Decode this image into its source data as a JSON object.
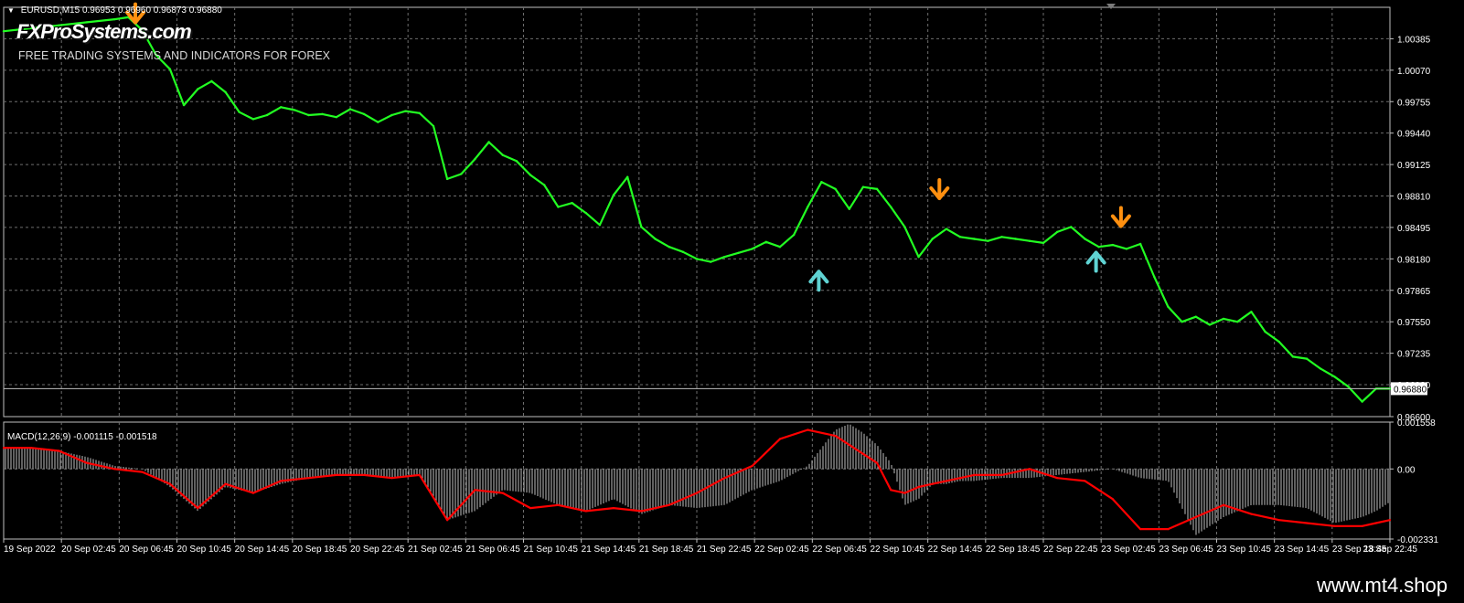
{
  "header": {
    "symbol_info": "EURUSD,M15  0.96953 0.96960 0.96873 0.96880",
    "brand_name": "FXProSystems.com",
    "brand_tagline": "FREE TRADING SYSTEMS AND INDICATORS FOR FOREX"
  },
  "footer": {
    "url": "www.mt4.shop"
  },
  "colors": {
    "background": "#000000",
    "grid": "#6e6e6e",
    "price": "#22ff22",
    "macd_histogram": "#c0c0c0",
    "signal_line": "#ff0000",
    "buy_arrow": "#5fd3d3",
    "sell_arrow": "#ff9010",
    "axis_text": "#ffffff"
  },
  "chart_data": [
    {
      "type": "line",
      "panel": "price",
      "symbol": "EURUSD",
      "timeframe": "M15",
      "ohlc_last": {
        "open": 0.96953,
        "high": 0.9696,
        "low": 0.96873,
        "close": 0.9688
      },
      "ylim": [
        0.966,
        1.007
      ],
      "y_ticks": [
        "1.00385",
        "1.00070",
        "0.99755",
        "0.99440",
        "0.99125",
        "0.98810",
        "0.98495",
        "0.98180",
        "0.97865",
        "0.97550",
        "0.97235",
        "0.96920",
        "0.96600"
      ],
      "current_price_label": "0.96880",
      "x_ticks": [
        "19 Sep 2022",
        "20 Sep 02:45",
        "20 Sep 06:45",
        "20 Sep 10:45",
        "20 Sep 14:45",
        "20 Sep 18:45",
        "20 Sep 22:45",
        "21 Sep 02:45",
        "21 Sep 06:45",
        "21 Sep 10:45",
        "21 Sep 14:45",
        "21 Sep 18:45",
        "21 Sep 22:45",
        "22 Sep 02:45",
        "22 Sep 06:45",
        "22 Sep 10:45",
        "22 Sep 14:45",
        "22 Sep 18:45",
        "22 Sep 22:45",
        "23 Sep 02:45",
        "23 Sep 06:45",
        "23 Sep 10:45",
        "23 Sep 14:45",
        "23 Sep 18:45",
        "23 Sep 22:45"
      ],
      "series": [
        {
          "x": [
            0,
            2,
            4,
            6,
            8,
            9,
            10,
            11,
            12,
            13,
            14,
            15,
            16,
            17,
            18,
            19,
            20,
            21,
            22,
            23,
            24,
            25,
            26,
            27,
            28,
            29,
            30,
            31,
            32,
            33,
            34,
            35,
            36,
            37,
            38,
            39,
            40,
            41,
            42,
            43,
            44,
            45,
            46,
            47,
            48,
            49,
            50,
            51,
            52,
            53,
            54,
            55,
            56,
            57,
            58,
            59,
            60,
            61,
            62,
            63,
            64,
            65,
            66,
            67,
            68,
            69,
            70,
            71,
            72,
            73,
            74,
            75,
            76,
            77,
            78,
            79,
            80,
            81,
            82,
            83,
            84,
            85,
            86,
            87,
            88,
            89,
            90,
            91,
            92,
            93,
            94,
            95,
            96,
            97,
            98,
            99,
            100
          ],
          "y": [
            1.0046,
            1.0049,
            1.0052,
            1.0055,
            1.0058,
            1.006,
            1.0047,
            1.0022,
            1.0008,
            0.9972,
            0.9988,
            0.9996,
            0.9985,
            0.9965,
            0.9958,
            0.9962,
            0.997,
            0.9967,
            0.9962,
            0.9963,
            0.996,
            0.9968,
            0.9963,
            0.9955,
            0.9962,
            0.9966,
            0.9964,
            0.9951,
            0.9898,
            0.9903,
            0.9918,
            0.9935,
            0.9922,
            0.9916,
            0.9902,
            0.9892,
            0.987,
            0.9874,
            0.9864,
            0.9852,
            0.9882,
            0.99,
            0.985,
            0.9838,
            0.983,
            0.9825,
            0.9818,
            0.9815,
            0.982,
            0.9824,
            0.9828,
            0.9835,
            0.983,
            0.9842,
            0.987,
            0.9895,
            0.9888,
            0.9868,
            0.989,
            0.9888,
            0.987,
            0.985,
            0.982,
            0.9838,
            0.9848,
            0.984,
            0.9838,
            0.9836,
            0.984,
            0.9838,
            0.9836,
            0.9834,
            0.9845,
            0.985,
            0.9838,
            0.983,
            0.9832,
            0.9828,
            0.9833,
            0.98,
            0.977,
            0.9755,
            0.976,
            0.9752,
            0.9758,
            0.9755,
            0.9765,
            0.9745,
            0.9735,
            0.972,
            0.9718,
            0.9708,
            0.97,
            0.969,
            0.9675,
            0.9688,
            0.9688
          ]
        }
      ],
      "signals": [
        {
          "type": "sell",
          "x": 9.5,
          "y": 1.0063
        },
        {
          "type": "buy",
          "x": 58.8,
          "y": 0.9797
        },
        {
          "type": "sell",
          "x": 67.5,
          "y": 0.9887
        },
        {
          "type": "buy",
          "x": 78.8,
          "y": 0.9816
        },
        {
          "type": "sell",
          "x": 80.6,
          "y": 0.9859
        }
      ]
    },
    {
      "type": "bar",
      "panel": "indicator",
      "title": "MACD(12,26,9) -0.001115 -0.001518",
      "indicator": "MACD",
      "parameters": [
        12,
        26,
        9
      ],
      "main_value": -0.001115,
      "signal_value": -0.001518,
      "ylim": [
        -0.002331,
        0.001558
      ],
      "y_ticks": [
        "0.001558",
        "0.00",
        "-0.002331"
      ],
      "series": [
        {
          "name": "MACD",
          "type": "bar",
          "x": [
            0,
            2,
            4,
            6,
            8,
            10,
            12,
            14,
            16,
            18,
            20,
            22,
            24,
            26,
            28,
            30,
            32,
            34,
            36,
            38,
            40,
            42,
            44,
            46,
            48,
            50,
            52,
            54,
            56,
            58,
            60,
            61,
            62,
            63,
            64,
            65,
            66,
            67,
            68,
            69,
            70,
            72,
            74,
            76,
            78,
            80,
            82,
            84,
            86,
            88,
            90,
            92,
            94,
            96,
            98,
            99,
            100
          ],
          "y": [
            0.0007,
            0.0007,
            0.0006,
            0.0004,
            0.0001,
            0.0,
            -0.0006,
            -0.0014,
            -0.0006,
            -0.0008,
            -0.0005,
            -0.0003,
            -0.0002,
            -0.0002,
            -0.0003,
            -0.0002,
            -0.0017,
            -0.0014,
            -0.0007,
            -0.0008,
            -0.0012,
            -0.0014,
            -0.001,
            -0.0015,
            -0.0012,
            -0.0013,
            -0.0012,
            -0.0007,
            -0.0004,
            0.0001,
            0.0013,
            0.0015,
            0.0012,
            0.0008,
            0.0002,
            -0.0012,
            -0.001,
            -0.0005,
            -0.0005,
            -0.0004,
            -0.0004,
            -0.0003,
            -0.0003,
            -0.0002,
            -0.0001,
            0.0,
            -0.0003,
            -0.0004,
            -0.0022,
            -0.0016,
            -0.0012,
            -0.0012,
            -0.0013,
            -0.0018,
            -0.0016,
            -0.0014,
            -0.0011
          ]
        },
        {
          "name": "Signal",
          "type": "line",
          "x": [
            0,
            2,
            4,
            6,
            8,
            10,
            12,
            14,
            16,
            18,
            20,
            22,
            24,
            26,
            28,
            30,
            32,
            34,
            36,
            38,
            40,
            42,
            44,
            46,
            48,
            50,
            52,
            54,
            56,
            58,
            60,
            61,
            62,
            63,
            64,
            65,
            66,
            67,
            68,
            69,
            70,
            72,
            74,
            76,
            78,
            80,
            82,
            84,
            86,
            88,
            90,
            92,
            94,
            96,
            98,
            99,
            100
          ],
          "y": [
            0.0007,
            0.0007,
            0.0006,
            0.0002,
            0.0,
            -0.0001,
            -0.0005,
            -0.0013,
            -0.0005,
            -0.0008,
            -0.0004,
            -0.0003,
            -0.0002,
            -0.0002,
            -0.0003,
            -0.0002,
            -0.0017,
            -0.0007,
            -0.0008,
            -0.0013,
            -0.0012,
            -0.0014,
            -0.0013,
            -0.0014,
            -0.0012,
            -0.0008,
            -0.0003,
            0.0001,
            0.001,
            0.0013,
            0.0011,
            0.0008,
            0.0005,
            0.0002,
            -0.0007,
            -0.0008,
            -0.0006,
            -0.0005,
            -0.0004,
            -0.0003,
            -0.0002,
            -0.0002,
            0.0,
            -0.0003,
            -0.0004,
            -0.001,
            -0.002,
            -0.002,
            -0.0016,
            -0.0012,
            -0.0015,
            -0.0017,
            -0.0018,
            -0.0019,
            -0.0019,
            -0.0018,
            -0.0017
          ]
        }
      ]
    }
  ]
}
